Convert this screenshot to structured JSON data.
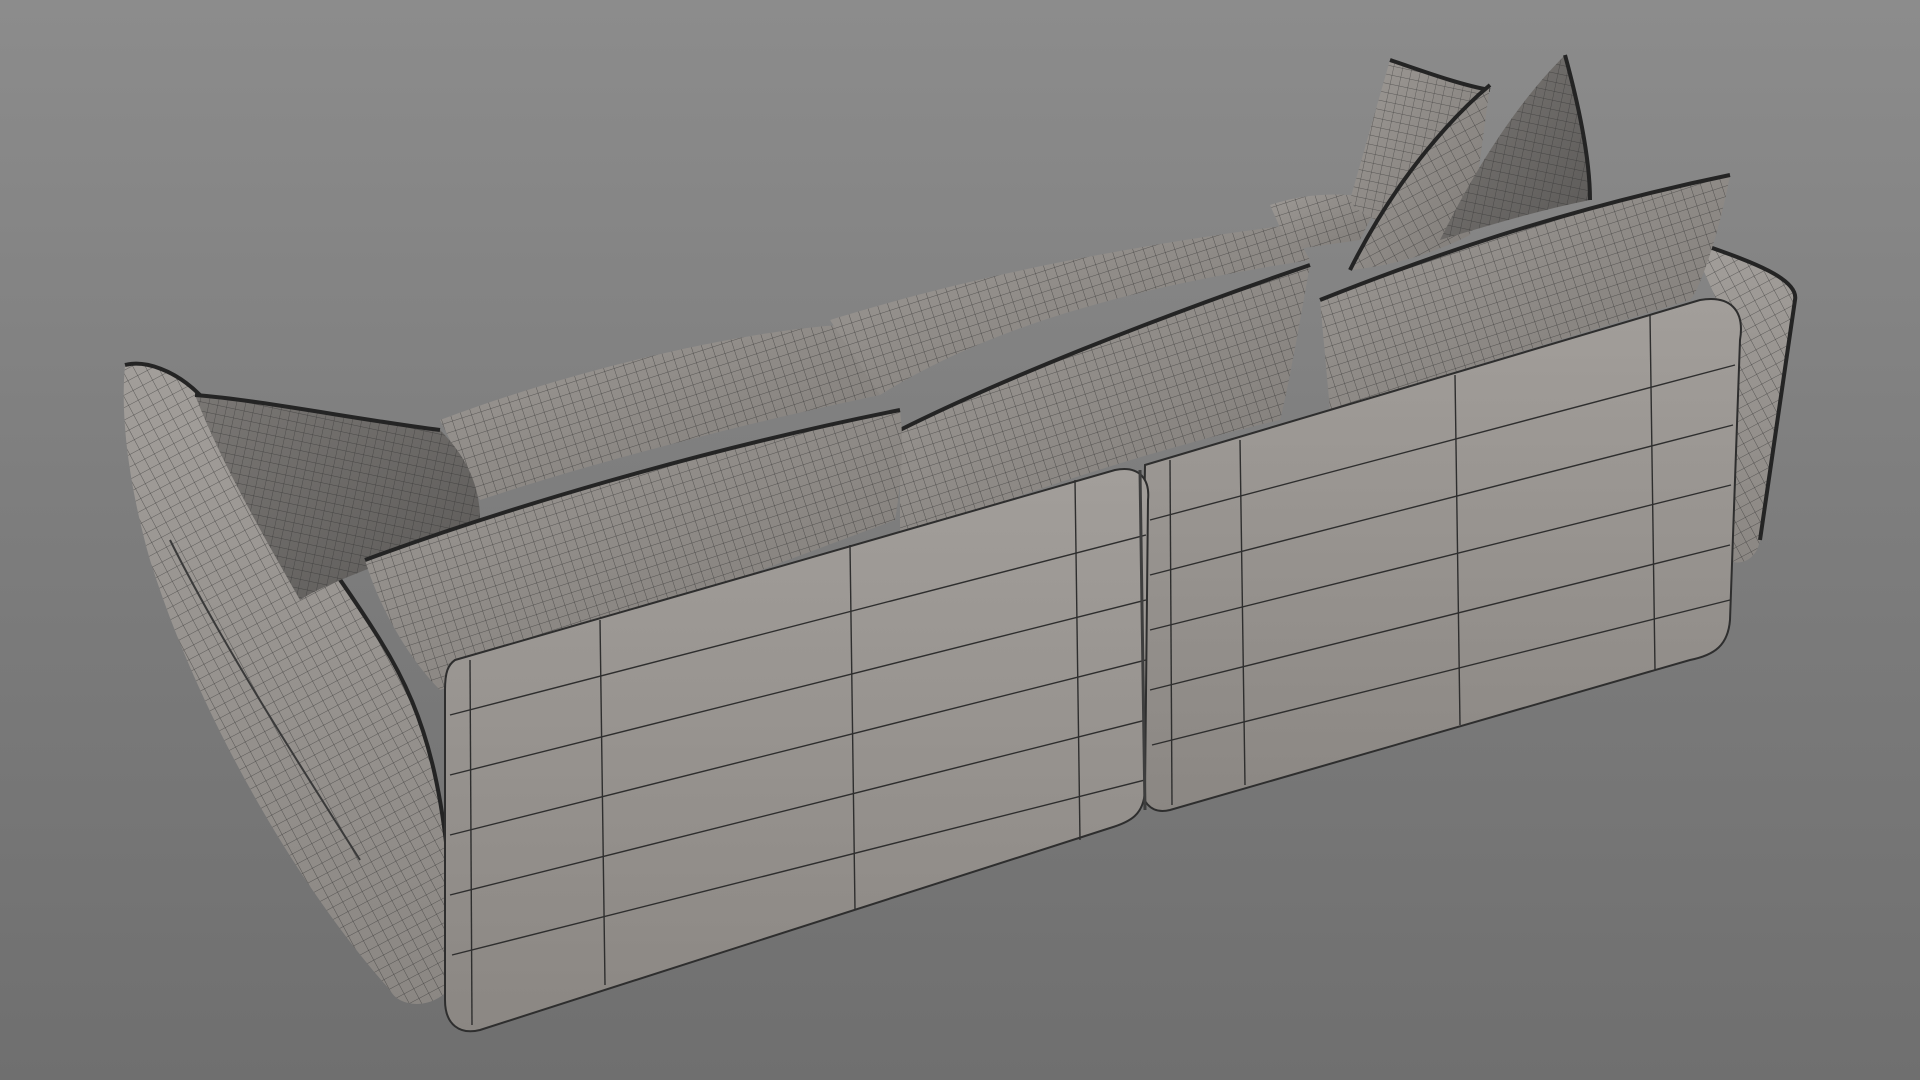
{
  "scene": {
    "subject": "sofa-wireframe",
    "colors": {
      "background_top": "#8c8c8c",
      "background_bottom": "#6f6f6f",
      "surface": "#8e8a86",
      "surface_light": "#a3a09c",
      "surface_dark": "#6c6966",
      "wire": "#2e2e2e",
      "piping": "#242424"
    }
  }
}
